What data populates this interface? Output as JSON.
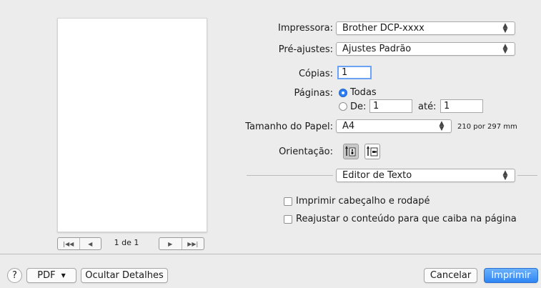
{
  "preview": {
    "page_count": "1 de 1"
  },
  "printer": {
    "label": "Impressora:",
    "value": "Brother DCP-xxxx"
  },
  "presets": {
    "label": "Pré-ajustes:",
    "value": "Ajustes Padrão"
  },
  "copies": {
    "label": "Cópias:",
    "value": "1"
  },
  "pages": {
    "label": "Páginas:",
    "all_label": "Todas",
    "from_label": "De:",
    "from_value": "1",
    "to_label": "até:",
    "to_value": "1"
  },
  "paper_size": {
    "label": "Tamanho do Papel:",
    "value": "A4",
    "dimensions": "210 por 297 mm"
  },
  "orientation": {
    "label": "Orientação:"
  },
  "section": {
    "value": "Editor de Texto"
  },
  "options": {
    "header_footer": "Imprimir cabeçalho e rodapé",
    "fit_page": "Reajustar o conteúdo para que caiba na página"
  },
  "footer": {
    "help": "?",
    "pdf": "PDF",
    "hide_details": "Ocultar Detalhes",
    "cancel": "Cancelar",
    "print": "Imprimir"
  },
  "colors": {
    "accent": "#2e86f4"
  },
  "icons": [
    "help-icon",
    "chevron-down-icon",
    "first-page-icon",
    "prev-page-icon",
    "next-page-icon",
    "last-page-icon",
    "portrait-icon",
    "landscape-icon",
    "updown-arrows-icon"
  ]
}
